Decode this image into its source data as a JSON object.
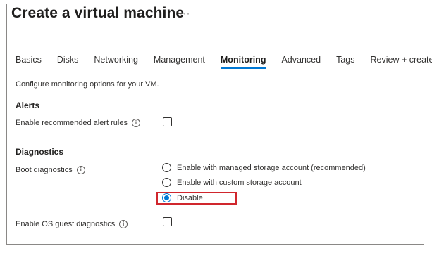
{
  "page": {
    "title": "Create a virtual machine",
    "more_label": "···"
  },
  "tabs": [
    {
      "label": "Basics",
      "active": false
    },
    {
      "label": "Disks",
      "active": false
    },
    {
      "label": "Networking",
      "active": false
    },
    {
      "label": "Management",
      "active": false
    },
    {
      "label": "Monitoring",
      "active": true
    },
    {
      "label": "Advanced",
      "active": false
    },
    {
      "label": "Tags",
      "active": false
    },
    {
      "label": "Review + create",
      "active": false
    }
  ],
  "description": "Configure monitoring options for your VM.",
  "alerts": {
    "heading": "Alerts",
    "enable_rules_label": "Enable recommended alert rules",
    "enable_rules_checked": false
  },
  "diagnostics": {
    "heading": "Diagnostics",
    "boot_label": "Boot diagnostics",
    "boot_options": [
      {
        "label": "Enable with managed storage account (recommended)",
        "checked": false
      },
      {
        "label": "Enable with custom storage account",
        "checked": false
      },
      {
        "label": "Disable",
        "checked": true
      }
    ],
    "os_guest_label": "Enable OS guest diagnostics",
    "os_guest_checked": false
  },
  "icons": {
    "info": "info-icon"
  },
  "colors": {
    "accent": "#0078d4",
    "highlight": "#d0262d"
  }
}
